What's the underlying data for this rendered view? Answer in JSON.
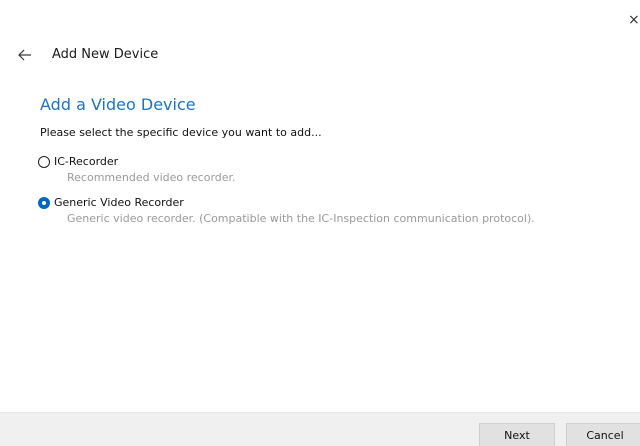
{
  "window": {
    "close_glyph": "×"
  },
  "header": {
    "title": "Add New Device",
    "back_icon": "arrow-left-icon"
  },
  "content": {
    "section_title": "Add a Video Device",
    "instruction": "Please select the specific device you want to add...",
    "options": [
      {
        "label": "IC-Recorder",
        "description": "Recommended video recorder.",
        "selected": false
      },
      {
        "label": "Generic Video Recorder",
        "description": "Generic video recorder. (Compatible with the IC-Inspection communication protocol).",
        "selected": true
      }
    ]
  },
  "footer": {
    "next_label": "Next",
    "cancel_label": "Cancel"
  },
  "colors": {
    "accent": "#1e73be",
    "radio_checked": "#0067c0",
    "description_text": "#9a9a9a",
    "footer_bg": "#f0f0f0",
    "button_bg": "#e1e1e1"
  }
}
